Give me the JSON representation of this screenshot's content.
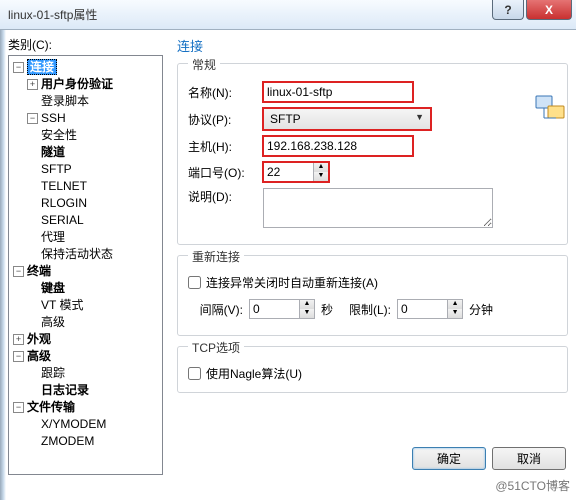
{
  "title": "linux-01-sftp属性",
  "help_glyph": "?",
  "close_glyph": "X",
  "category_label": "类别(C):",
  "tree": {
    "root": "连接",
    "items": {
      "user_auth": "用户身份验证",
      "login_script": "登录脚本",
      "ssh": "SSH",
      "security": "安全性",
      "tunnel": "隧道",
      "sftp": "SFTP",
      "telnet": "TELNET",
      "rlogin": "RLOGIN",
      "serial": "SERIAL",
      "proxy": "代理",
      "keepalive": "保持活动状态",
      "terminal": "终端",
      "keyboard": "键盘",
      "vt": "VT 模式",
      "advanced_term": "高级",
      "appearance": "外观",
      "advanced": "高级",
      "trace": "跟踪",
      "logging": "日志记录",
      "file_transfer": "文件传输",
      "xymodem": "X/YMODEM",
      "zmodem": "ZMODEM"
    }
  },
  "form": {
    "heading": "连接",
    "general_legend": "常规",
    "name_label": "名称(N):",
    "name_value": "linux-01-sftp",
    "protocol_label": "协议(P):",
    "protocol_value": "SFTP",
    "host_label": "主机(H):",
    "host_value": "192.168.238.128",
    "port_label": "端口号(O):",
    "port_value": "22",
    "desc_label": "说明(D):",
    "desc_value": "",
    "reconnect_legend": "重新连接",
    "reconnect_chk": "连接异常关闭时自动重新连接(A)",
    "interval_label": "间隔(V):",
    "interval_value": "0",
    "seconds": "秒",
    "limit_label": "限制(L):",
    "limit_value": "0",
    "minutes": "分钟",
    "tcp_legend": "TCP选项",
    "nagle_chk": "使用Nagle算法(U)"
  },
  "buttons": {
    "ok": "确定",
    "cancel": "取消"
  },
  "watermark": "@51CTO博客"
}
